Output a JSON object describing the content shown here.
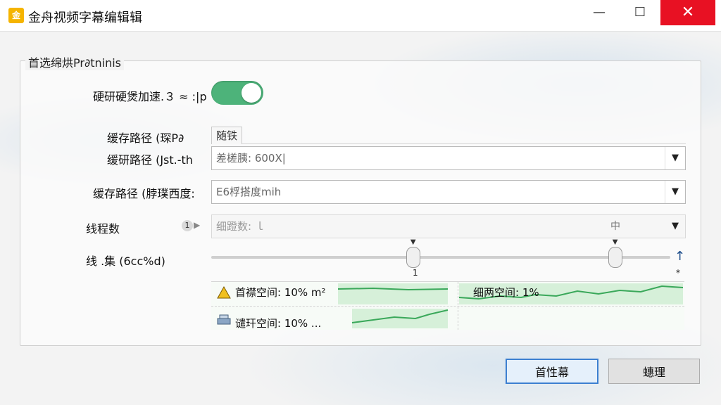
{
  "titlebar": {
    "title": "金舟视频字幕编辑辑",
    "icon": "app-logo-icon",
    "buttons": {
      "minimize": "—",
      "maximize": "☐",
      "close": "✕"
    }
  },
  "group": {
    "title": "首选绵烘Pr∂tninis"
  },
  "settings": {
    "hw_label": "硬研硬煲加速.３ ≈ :|p",
    "hw_toggle_on": true,
    "cache_tab_label": "缓存路径 (琛P∂",
    "cache_tab_value": "随铁",
    "cache_path2_label": "缓研路径 (Jst.-th",
    "cache_path2_value": "差槎胰: 600X|",
    "cache_path3_label": "缓存路径 (脖璞西度:",
    "cache_path3_value": "E6桴搭度mih",
    "threads_label": "线程数",
    "threads_badge": "1",
    "threads_value": "细蹬数: ｌ",
    "threads_extra": "中",
    "slider_label": "线  .集 (6cc%d)",
    "slider_tick_left": "1",
    "slider_tick_right": "*",
    "slider_values": [
      0.44,
      0.88
    ]
  },
  "graphs": {
    "cell1": "首襟空间: 10% m²",
    "cell2": "细两空间: 1%",
    "cell3": "谴玕空间: 10% ...",
    "line_color": "#3aa85a",
    "fill_color": "#d6f0d9"
  },
  "buttons": {
    "primary": "首性幕",
    "secondary": "蟪理"
  }
}
